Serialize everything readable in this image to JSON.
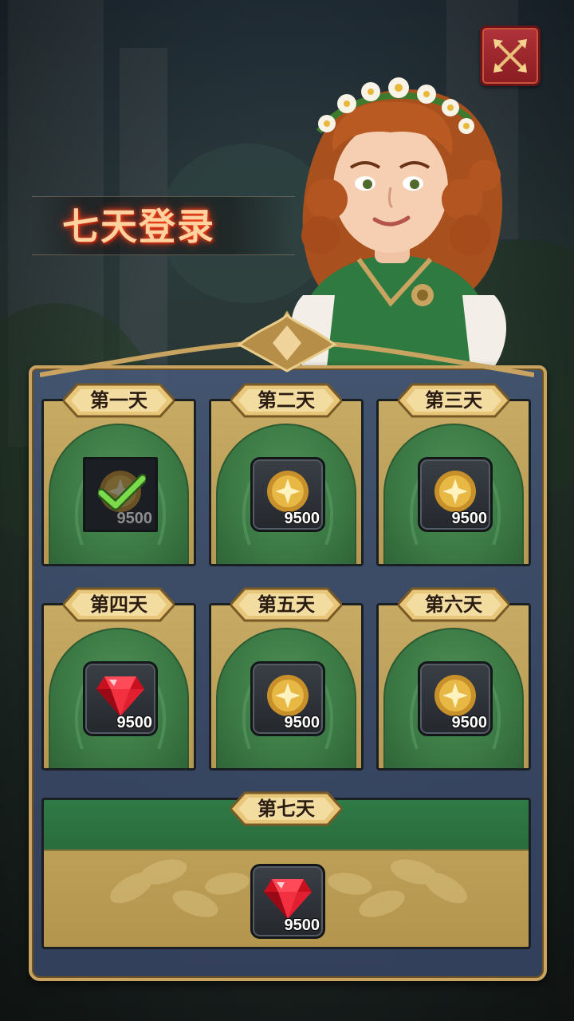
{
  "title": "七天登录",
  "days": [
    {
      "label": "第一天",
      "reward": "coin",
      "amount": "9500",
      "claimed": true
    },
    {
      "label": "第二天",
      "reward": "coin",
      "amount": "9500",
      "claimed": false
    },
    {
      "label": "第三天",
      "reward": "coin",
      "amount": "9500",
      "claimed": false
    },
    {
      "label": "第四天",
      "reward": "ruby",
      "amount": "9500",
      "claimed": false
    },
    {
      "label": "第五天",
      "reward": "coin",
      "amount": "9500",
      "claimed": false
    },
    {
      "label": "第六天",
      "reward": "coin",
      "amount": "9500",
      "claimed": false
    },
    {
      "label": "第七天",
      "reward": "ruby",
      "amount": "9500",
      "claimed": false
    }
  ],
  "icons": {
    "close": "close-swords-icon",
    "coin": "gold-coin-icon",
    "ruby": "ruby-gem-icon",
    "check": "checkmark-icon"
  },
  "colors": {
    "title_glow": "#ff4a1a",
    "panel_border": "#c9a461",
    "card_green": "#3c7a45",
    "card_gold": "#c7ab64",
    "close_button": "#9a242b"
  }
}
